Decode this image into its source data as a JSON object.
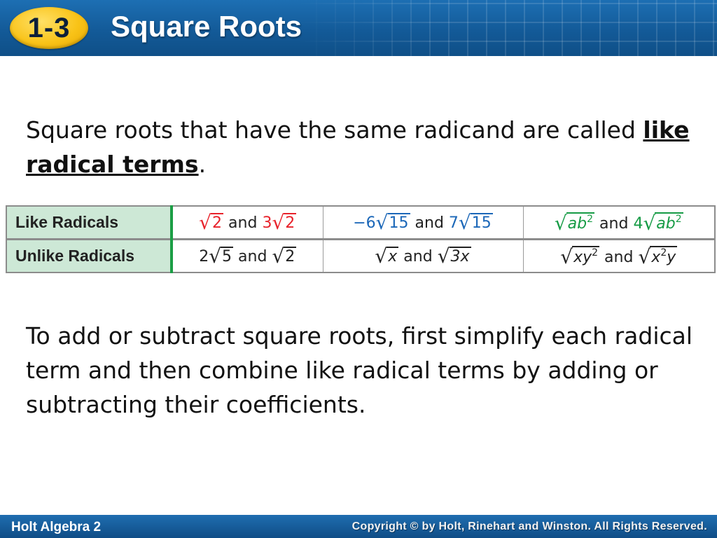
{
  "header": {
    "lesson_number": "1-3",
    "title": "Square Roots"
  },
  "intro": {
    "before": "Square roots that have the same radicand are called ",
    "term": "like radical terms",
    "after": "."
  },
  "table": {
    "rows": [
      {
        "label": "Like Radicals",
        "examples": [
          {
            "a_coef": "",
            "a_radicand": "2",
            "joiner": "and",
            "b_coef": "3",
            "b_radicand": "2",
            "color": "#e8222b"
          },
          {
            "a_coef": "−6",
            "a_radicand": "15",
            "joiner": "and",
            "b_coef": "7",
            "b_radicand": "15",
            "color": "#1b67b8"
          },
          {
            "a_coef": "",
            "a_radicand": "ab",
            "a_sup": "2",
            "joiner": "and",
            "b_coef": "4",
            "b_radicand": "ab",
            "b_sup": "2",
            "color": "#169b45"
          }
        ]
      },
      {
        "label": "Unlike Radicals",
        "examples": [
          {
            "a_coef": "2",
            "a_radicand": "5",
            "joiner": "and",
            "b_coef": "",
            "b_radicand": "2"
          },
          {
            "a_coef": "",
            "a_radicand": "x",
            "joiner": "and",
            "b_coef": "",
            "b_radicand": "3x"
          },
          {
            "a_coef": "",
            "a_radicand": "xy",
            "a_sup": "2",
            "joiner": "and",
            "b_coef": "",
            "b_radicand_pre": "x",
            "b_pre_sup": "2",
            "b_radicand_post": "y"
          }
        ]
      }
    ]
  },
  "body": {
    "text": "To add or subtract square roots, first simplify each radical term and then combine like radical terms by adding or subtracting their coefficients."
  },
  "footer": {
    "left": "Holt Algebra 2",
    "right": "Copyright © by Holt, Rinehart and Winston. All Rights Reserved."
  }
}
